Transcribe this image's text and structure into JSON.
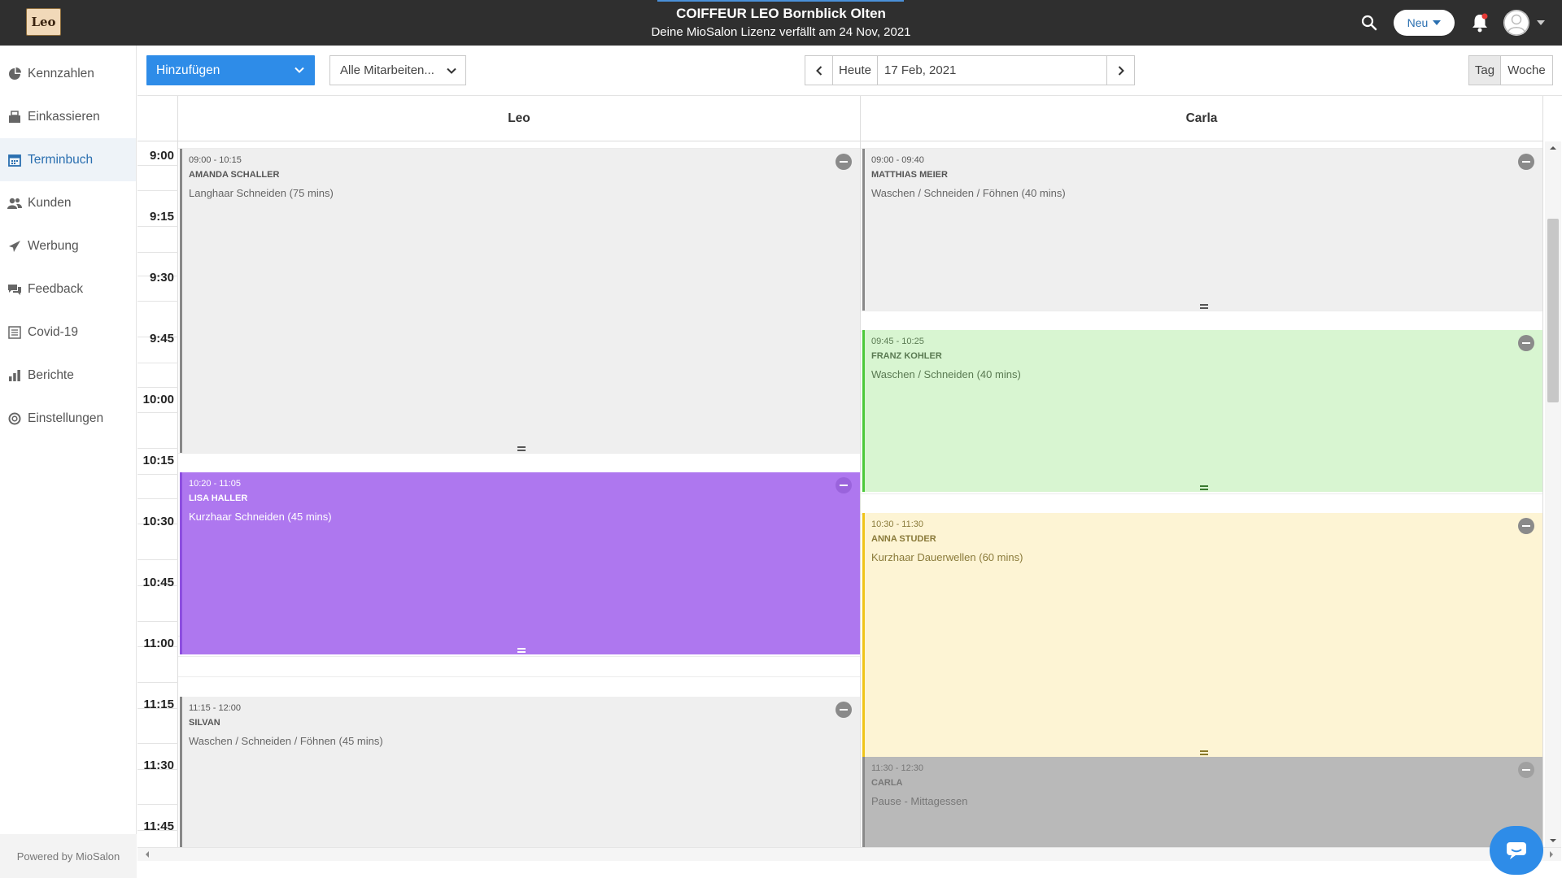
{
  "header": {
    "logo_text": "Leo",
    "salon_name": "COIFFEUR LEO Bornblick Olten",
    "license_notice": "Deine MioSalon Lizenz verfällt am 24 Nov, 2021",
    "new_button": "Neu",
    "accent_color": "#4a90d9"
  },
  "sidebar": {
    "items": [
      {
        "label": "Kennzahlen",
        "icon": "pie-chart-icon"
      },
      {
        "label": "Einkassieren",
        "icon": "register-icon"
      },
      {
        "label": "Terminbuch",
        "icon": "calendar-icon",
        "active": true
      },
      {
        "label": "Kunden",
        "icon": "users-icon"
      },
      {
        "label": "Werbung",
        "icon": "paper-plane-icon"
      },
      {
        "label": "Feedback",
        "icon": "comments-icon"
      },
      {
        "label": "Covid-19",
        "icon": "list-icon"
      },
      {
        "label": "Berichte",
        "icon": "bar-chart-icon"
      },
      {
        "label": "Einstellungen",
        "icon": "lifebuoy-icon"
      }
    ],
    "powered_by": "Powered by MioSalon"
  },
  "toolbar": {
    "add_button": "Hinzufügen",
    "staff_filter": "Alle Mitarbeiten...",
    "today_button": "Heute",
    "date": "17 Feb, 2021",
    "view_day": "Tag",
    "view_week": "Woche"
  },
  "calendar": {
    "staff": [
      "Leo",
      "Carla"
    ],
    "time_labels": [
      "9:00",
      "9:15",
      "9:30",
      "9:45",
      "10:00",
      "10:15",
      "10:30",
      "10:45",
      "11:00",
      "11:15",
      "11:30",
      "11:45"
    ],
    "leo": [
      {
        "time": "09:00 - 10:15",
        "client": "AMANDA SCHALLER",
        "service": "Langhaar Schneiden (75 mins)",
        "style": "gray"
      },
      {
        "time": "10:20 - 11:05",
        "client": "LISA HALLER",
        "service": "Kurzhaar Schneiden (45 mins)",
        "style": "purple"
      },
      {
        "time": "11:15 - 12:00",
        "client": "SILVAN",
        "service": "Waschen / Schneiden / Föhnen (45 mins)",
        "style": "gray"
      }
    ],
    "carla": [
      {
        "time": "09:00 - 09:40",
        "client": "MATTHIAS MEIER",
        "service": "Waschen / Schneiden / Föhnen (40 mins)",
        "style": "gray"
      },
      {
        "time": "09:45 - 10:25",
        "client": "FRANZ KOHLER",
        "service": "Waschen / Schneiden (40 mins)",
        "style": "green"
      },
      {
        "time": "10:30 - 11:30",
        "client": "ANNA STUDER",
        "service": "Kurzhaar Dauerwellen (60 mins)",
        "style": "yellow"
      },
      {
        "time": "11:30 - 12:30",
        "client": "CARLA",
        "service": "Pause - Mittagessen",
        "style": "break"
      }
    ]
  }
}
